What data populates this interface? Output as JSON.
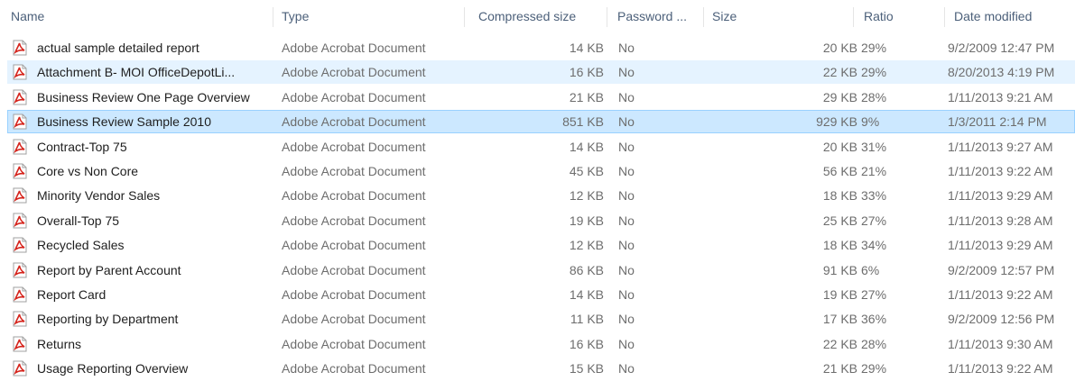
{
  "columns": {
    "name": "Name",
    "type": "Type",
    "compressed_size": "Compressed size",
    "password": "Password ...",
    "size": "Size",
    "ratio": "Ratio",
    "date_modified": "Date modified"
  },
  "files": [
    {
      "name": "actual sample detailed report",
      "type": "Adobe Acrobat Document",
      "compressed": "14 KB",
      "password": "No",
      "size": "20 KB",
      "ratio": "29%",
      "date": "9/2/2009 12:47 PM",
      "icon": "pdf-icon",
      "state": "normal"
    },
    {
      "name": "Attachment B- MOI OfficeDepotLi...",
      "type": "Adobe Acrobat Document",
      "compressed": "16 KB",
      "password": "No",
      "size": "22 KB",
      "ratio": "29%",
      "date": "8/20/2013 4:19 PM",
      "icon": "pdf-icon",
      "state": "hover"
    },
    {
      "name": "Business Review One Page Overview",
      "type": "Adobe Acrobat Document",
      "compressed": "21 KB",
      "password": "No",
      "size": "29 KB",
      "ratio": "28%",
      "date": "1/11/2013 9:21 AM",
      "icon": "pdf-icon",
      "state": "normal"
    },
    {
      "name": "Business Review Sample 2010",
      "type": "Adobe Acrobat Document",
      "compressed": "851 KB",
      "password": "No",
      "size": "929 KB",
      "ratio": "9%",
      "date": "1/3/2011 2:14 PM",
      "icon": "pdf-icon",
      "state": "selected"
    },
    {
      "name": "Contract-Top 75",
      "type": "Adobe Acrobat Document",
      "compressed": "14 KB",
      "password": "No",
      "size": "20 KB",
      "ratio": "31%",
      "date": "1/11/2013 9:27 AM",
      "icon": "pdf-icon",
      "state": "normal"
    },
    {
      "name": "Core vs Non Core",
      "type": "Adobe Acrobat Document",
      "compressed": "45 KB",
      "password": "No",
      "size": "56 KB",
      "ratio": "21%",
      "date": "1/11/2013 9:22 AM",
      "icon": "pdf-icon",
      "state": "normal"
    },
    {
      "name": "Minority Vendor Sales",
      "type": "Adobe Acrobat Document",
      "compressed": "12 KB",
      "password": "No",
      "size": "18 KB",
      "ratio": "33%",
      "date": "1/11/2013 9:29 AM",
      "icon": "pdf-icon",
      "state": "normal"
    },
    {
      "name": "Overall-Top 75",
      "type": "Adobe Acrobat Document",
      "compressed": "19 KB",
      "password": "No",
      "size": "25 KB",
      "ratio": "27%",
      "date": "1/11/2013 9:28 AM",
      "icon": "pdf-icon",
      "state": "normal"
    },
    {
      "name": "Recycled Sales",
      "type": "Adobe Acrobat Document",
      "compressed": "12 KB",
      "password": "No",
      "size": "18 KB",
      "ratio": "34%",
      "date": "1/11/2013 9:29 AM",
      "icon": "pdf-icon",
      "state": "normal"
    },
    {
      "name": "Report by Parent Account",
      "type": "Adobe Acrobat Document",
      "compressed": "86 KB",
      "password": "No",
      "size": "91 KB",
      "ratio": "6%",
      "date": "9/2/2009 12:57 PM",
      "icon": "pdf-icon",
      "state": "normal"
    },
    {
      "name": "Report Card",
      "type": "Adobe Acrobat Document",
      "compressed": "14 KB",
      "password": "No",
      "size": "19 KB",
      "ratio": "27%",
      "date": "1/11/2013 9:22 AM",
      "icon": "pdf-icon",
      "state": "normal"
    },
    {
      "name": "Reporting by Department",
      "type": "Adobe Acrobat Document",
      "compressed": "11 KB",
      "password": "No",
      "size": "17 KB",
      "ratio": "36%",
      "date": "9/2/2009 12:56 PM",
      "icon": "pdf-icon",
      "state": "normal"
    },
    {
      "name": "Returns",
      "type": "Adobe Acrobat Document",
      "compressed": "16 KB",
      "password": "No",
      "size": "22 KB",
      "ratio": "28%",
      "date": "1/11/2013 9:30 AM",
      "icon": "pdf-icon",
      "state": "normal"
    },
    {
      "name": "Usage Reporting Overview",
      "type": "Adobe Acrobat Document",
      "compressed": "15 KB",
      "password": "No",
      "size": "21 KB",
      "ratio": "29%",
      "date": "1/11/2013 9:22 AM",
      "icon": "pdf-icon",
      "state": "normal"
    }
  ],
  "colors": {
    "header_text": "#4c607a",
    "hover_bg": "#e5f3ff",
    "selected_bg": "#cce8ff",
    "selected_border": "#99d1ff",
    "pdf_red": "#d5241c"
  }
}
